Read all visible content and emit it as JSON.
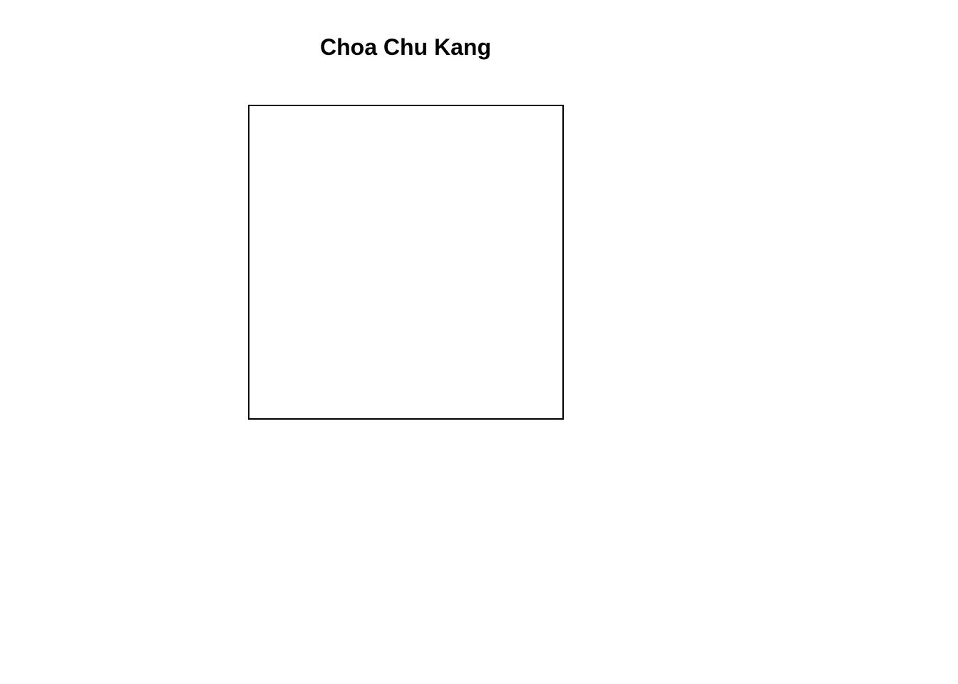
{
  "chart_data": {
    "type": "scatter",
    "title": "Choa Chu Kang",
    "xlabel": "",
    "ylabel": "",
    "series": [],
    "grid": false,
    "legend": "none"
  },
  "colors": {
    "background": "#ffffff",
    "frame": "#000000",
    "title": "#000000"
  }
}
